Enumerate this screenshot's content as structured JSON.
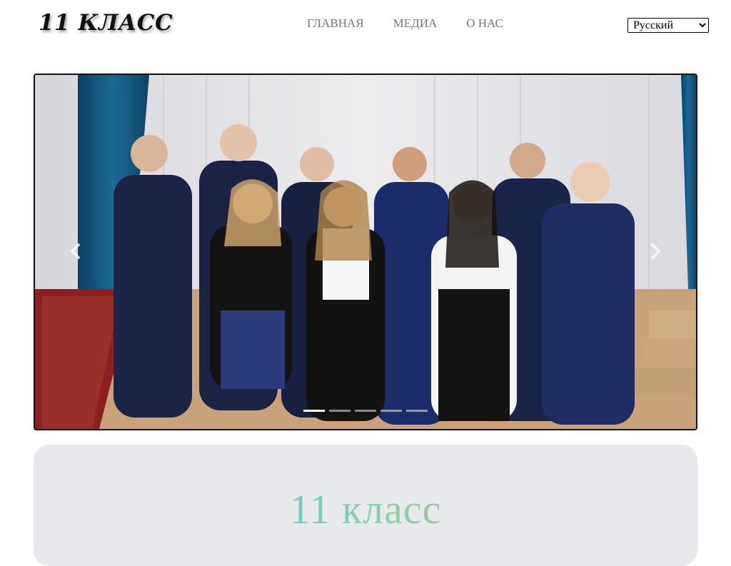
{
  "header": {
    "logo": "11 КЛАСС",
    "nav": [
      {
        "label": "ГЛАВНАЯ"
      },
      {
        "label": "МЕДИА"
      },
      {
        "label": "О НАС"
      }
    ],
    "language": {
      "selected": "Русский",
      "options": [
        "Русский"
      ]
    }
  },
  "carousel": {
    "icons": {
      "prev": "chevron-left-icon",
      "next": "chevron-right-icon"
    },
    "slide_count": 5,
    "active_index": 0
  },
  "main": {
    "title": "11 класс"
  },
  "colors": {
    "nav_text": "#777777",
    "card_background": "#e8e9ec",
    "title_gradient": [
      "#8a7ad8",
      "#6ccfc3",
      "#c5a87c",
      "#e6855e"
    ]
  }
}
